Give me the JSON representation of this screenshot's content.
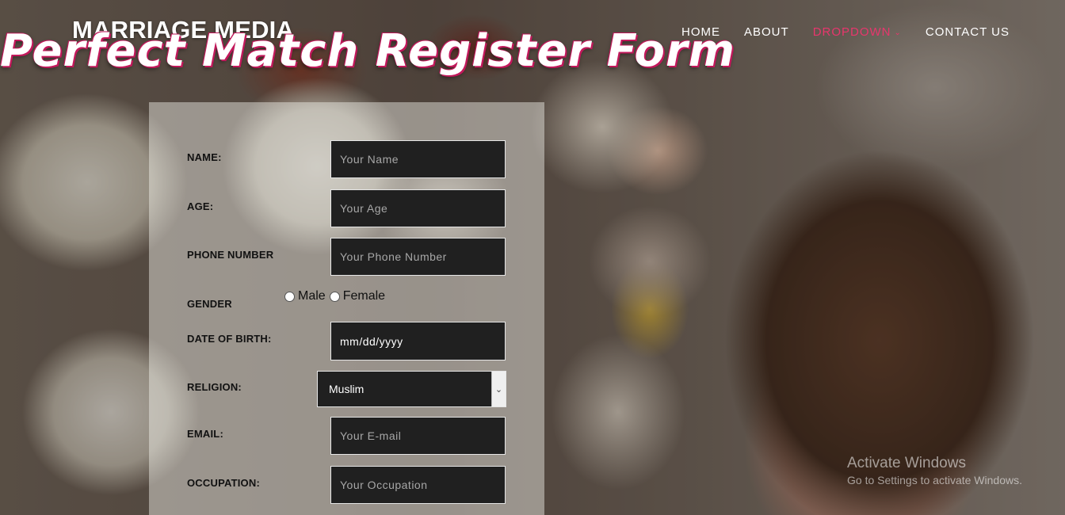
{
  "header": {
    "brand": "MARRIAGE MEDIA",
    "page_title": "Perfect Match Register Form"
  },
  "nav": {
    "items": [
      {
        "label": "HOME"
      },
      {
        "label": "ABOUT"
      },
      {
        "label": "DROPDOWN",
        "active": true,
        "icon": "chevron-down-icon"
      },
      {
        "label": "CONTACT US"
      }
    ]
  },
  "form": {
    "name": {
      "label": "NAME:",
      "placeholder": "Your Name"
    },
    "age": {
      "label": "AGE:",
      "placeholder": "Your Age"
    },
    "phone": {
      "label": "PHONE NUMBER",
      "placeholder": "Your Phone Number"
    },
    "gender": {
      "label": "GENDER",
      "options": [
        "Male",
        "Female"
      ]
    },
    "dob": {
      "label": "DATE OF BIRTH:",
      "value": "mm/dd/yyyy"
    },
    "religion": {
      "label": "RELIGION:",
      "selected": "Muslim"
    },
    "email": {
      "label": "EMAIL:",
      "placeholder": "Your E-mail"
    },
    "occupation": {
      "label": "OCCUPATION:",
      "placeholder": "Your Occupation"
    }
  },
  "watermark": {
    "title": "Activate Windows",
    "subtitle": "Go to Settings to activate Windows."
  },
  "colors": {
    "accent": "#e8366d",
    "input_bg": "#202020"
  }
}
